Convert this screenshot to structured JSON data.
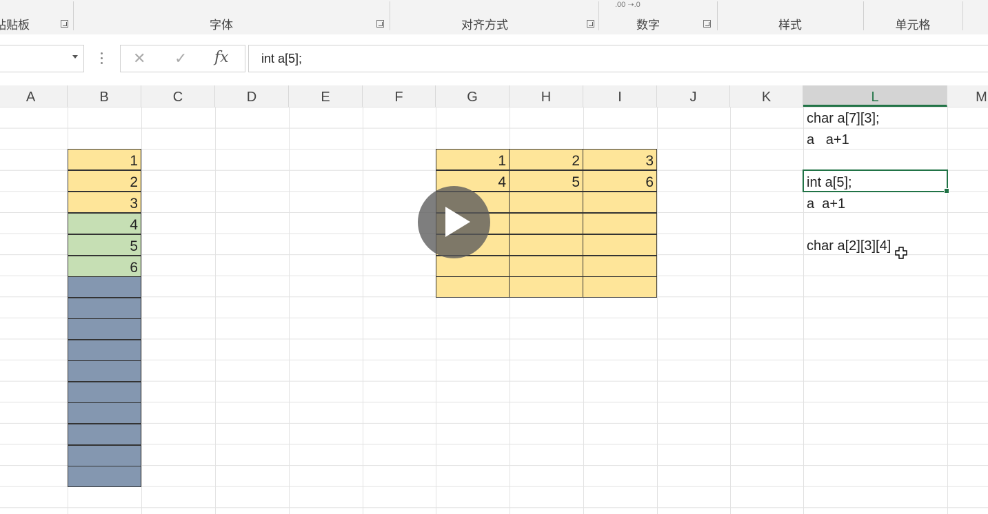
{
  "ribbon": {
    "groups": [
      {
        "label": "贴贴板"
      },
      {
        "label": "字体"
      },
      {
        "label": "对齐方式"
      },
      {
        "label": "数字"
      },
      {
        "label": "样式"
      },
      {
        "label": "单元格"
      }
    ]
  },
  "formula_bar": {
    "name_box": "",
    "cancel_icon": "✕",
    "enter_icon": "✓",
    "fx_label": "fx",
    "content": "int a[5];"
  },
  "columns": [
    "A",
    "B",
    "C",
    "D",
    "E",
    "F",
    "G",
    "H",
    "I",
    "J",
    "K",
    "L",
    "M"
  ],
  "selected_column": "L",
  "column_b": {
    "values": [
      "1",
      "2",
      "3",
      "4",
      "5",
      "6"
    ],
    "colors": {
      "yellow": "#fee599",
      "green": "#c6dfb4",
      "blue": "#8497b0"
    }
  },
  "block_ghi": {
    "row1": [
      "1",
      "2",
      "3"
    ],
    "row2": [
      "4",
      "5",
      "6"
    ]
  },
  "column_l": {
    "line1": "char a[7][3];",
    "line2": "a   a+1",
    "line3": "int a[5];",
    "line4": "a  a+1",
    "line5": "char a[2][3][4]"
  },
  "accent": "#217346"
}
